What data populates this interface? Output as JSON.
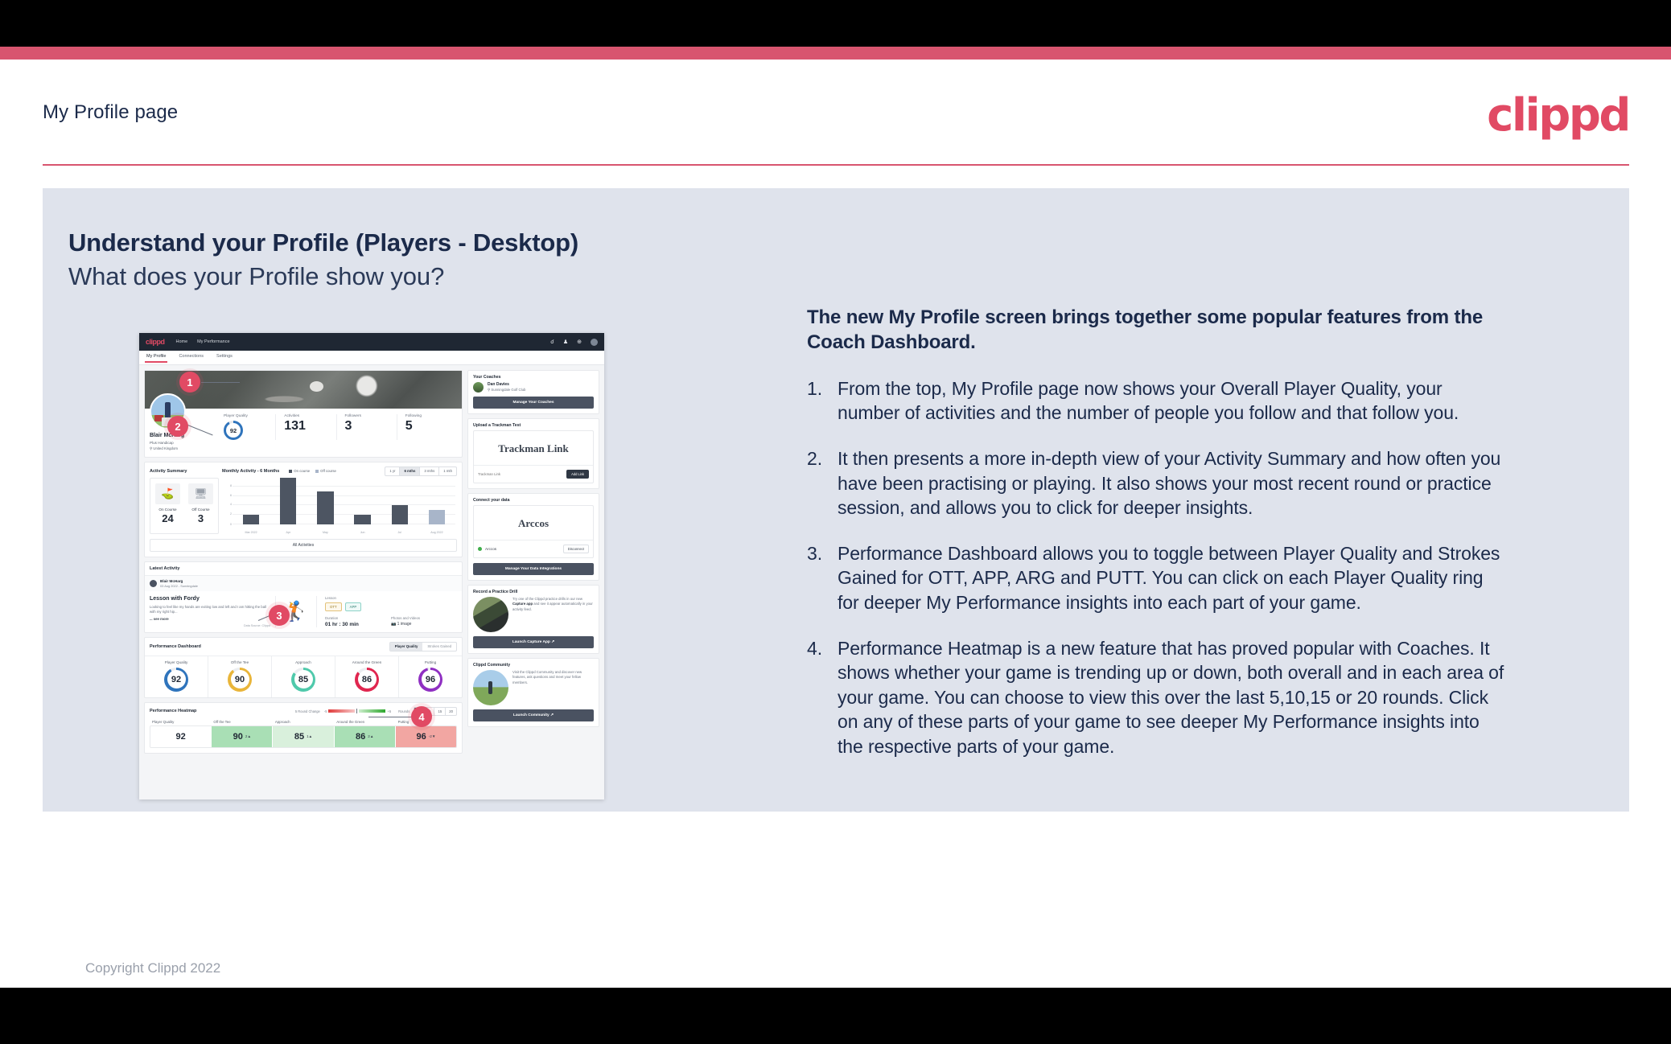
{
  "header": {
    "title": "My Profile page",
    "brand": "clippd"
  },
  "slide": {
    "title_main": "Understand your Profile (Players - Desktop)",
    "title_sub": "What does your Profile show you?",
    "copyright": "Copyright Clippd 2022"
  },
  "text_column": {
    "lead": "The new My Profile screen brings together some popular features from the Coach Dashboard.",
    "items": [
      {
        "num": "1.",
        "text": "From the top, My Profile page now shows your Overall Player Quality, your number of activities and the number of people you follow and that follow you."
      },
      {
        "num": "2.",
        "text": "It then presents a more in-depth view of your Activity Summary and how often you have been practising or playing. It also shows your most recent round or practice session, and allows you to click for deeper insights."
      },
      {
        "num": "3.",
        "text": "Performance Dashboard allows you to toggle between Player Quality and Strokes Gained for OTT, APP, ARG and PUTT. You can click on each Player Quality ring for deeper My Performance insights into each part of your game."
      },
      {
        "num": "4.",
        "text": "Performance Heatmap is a new feature that has proved popular with Coaches. It shows whether your game is trending up or down, both overall and in each area of your game. You can choose to view this over the last 5,10,15 or 20 rounds. Click on any of these parts of your game to see deeper My Performance insights into the respective parts of your game."
      }
    ]
  },
  "callouts": [
    {
      "label": "1"
    },
    {
      "label": "2"
    },
    {
      "label": "3"
    },
    {
      "label": "4"
    }
  ],
  "app": {
    "nav": {
      "logo": "clippd",
      "links": [
        "Home",
        "My Performance"
      ],
      "icons": [
        "search-icon",
        "community-icon",
        "add-circle-icon",
        "avatar-icon"
      ]
    },
    "tabs": [
      {
        "label": "My Profile",
        "active": true
      },
      {
        "label": "Connections",
        "active": false
      },
      {
        "label": "Settings",
        "active": false
      }
    ],
    "profile": {
      "name": "Blair McHarg",
      "handicap": "Plus Handicap",
      "location": "United Kingdom",
      "stats": [
        {
          "label": "Player Quality",
          "value": "92",
          "type": "ring",
          "color": "#2f74bc"
        },
        {
          "label": "Activities",
          "value": "131",
          "type": "number"
        },
        {
          "label": "Followers",
          "value": "3",
          "type": "number"
        },
        {
          "label": "Following",
          "value": "5",
          "type": "number"
        }
      ]
    },
    "activity_summary": {
      "heading": "Activity Summary",
      "chart_title": "Monthly Activity - 6 Months",
      "legend": [
        {
          "label": "On course",
          "color": "#4d5562"
        },
        {
          "label": "Off course",
          "color": "#a8b5c9"
        }
      ],
      "range_options": [
        "1 yr",
        "6 mths",
        "3 mths",
        "1 mth"
      ],
      "range_selected": "6 mths",
      "counters": [
        {
          "label": "On Course",
          "value": "24",
          "icon": "golf-flag-icon"
        },
        {
          "label": "Off Course",
          "value": "3",
          "icon": "monitor-icon"
        }
      ],
      "all_activities_label": "All Activities"
    },
    "latest_activity": {
      "heading": "Latest Activity",
      "user": "Blair McHarg",
      "meta": "03 Aug 2022 - Sunningdale",
      "title": "Lesson with Fordy",
      "description": "Looking to feel like my hands are exiting low and left and I am hitting the ball with my right hip...",
      "see_more": "... see more",
      "data_source": "Data Source: Clippd",
      "type_label": "Lesson",
      "tags": [
        "OTT",
        "APP"
      ],
      "duration_label": "Duration",
      "duration_value": "01 hr : 30 min",
      "photos_label": "Photos and Videos",
      "photos_value": "1 image"
    },
    "performance_dashboard": {
      "heading": "Performance Dashboard",
      "toggle": [
        "Player Quality",
        "Strokes Gained"
      ],
      "toggle_selected": "Player Quality",
      "rings": [
        {
          "label": "Player Quality",
          "value": "92",
          "color": "#2f74bc"
        },
        {
          "label": "Off the Tee",
          "value": "90",
          "color": "#e9b53a"
        },
        {
          "label": "Approach",
          "value": "85",
          "color": "#4fc9ab"
        },
        {
          "label": "Around the Green",
          "value": "86",
          "color": "#e0264f"
        },
        {
          "label": "Putting",
          "value": "96",
          "color": "#8f2fc2"
        }
      ]
    },
    "performance_heatmap": {
      "heading": "Performance Heatmap",
      "change_label": "5 Round Change",
      "scale_min": "-5",
      "scale_max": "+5",
      "rounds_label": "Rounds",
      "rounds_options": [
        "5",
        "10",
        "15",
        "20"
      ],
      "rounds_selected": "5",
      "cells": [
        {
          "label": "Player Quality",
          "value": "92",
          "delta": "",
          "arrow": "",
          "bg": "#ffffff"
        },
        {
          "label": "Off the Tee",
          "value": "90",
          "delta": "2",
          "arrow": "▲",
          "bg": "#a9dfb5"
        },
        {
          "label": "Approach",
          "value": "85",
          "delta": "1",
          "arrow": "▲",
          "bg": "#d9f0dc"
        },
        {
          "label": "Around the Green",
          "value": "86",
          "delta": "2",
          "arrow": "▲",
          "bg": "#a9dfb5"
        },
        {
          "label": "Putting",
          "value": "96",
          "delta": "-2",
          "arrow": "▼",
          "bg": "#f2a6a2"
        }
      ]
    },
    "sidebar": {
      "coaches": {
        "heading": "Your Coaches",
        "coach_name": "Dan Davies",
        "coach_club": "Sunningdale Golf Club",
        "button": "Manage Your Coaches"
      },
      "trackman": {
        "heading": "Upload a Trackman Test",
        "brand": "Trackman Link",
        "placeholder": "Trackman Link",
        "button": "Add Link"
      },
      "connect": {
        "heading": "Connect your data",
        "brand": "Arccos",
        "source": "Arccos",
        "button_small": "Disconnect",
        "button": "Manage Your Data Integrations"
      },
      "drill": {
        "heading": "Record a Practice Drill",
        "text_before": "Try one of the Clippd practice drills in our new ",
        "text_bold": "Capture app",
        "text_after": " and see it appear automatically in your activity feed.",
        "button": "Launch Capture App"
      },
      "community": {
        "heading": "Clippd Community",
        "text": "Visit the Clippd Community and discover new features, ask questions and meet your fellow members.",
        "button": "Launch Community"
      }
    }
  },
  "chart_data": {
    "type": "bar",
    "title": "Monthly Activity - 6 Months",
    "categories": [
      "Mar 2022",
      "Apr",
      "May",
      "Jun",
      "Jul",
      "Aug 2022"
    ],
    "values": [
      2,
      10,
      7,
      2,
      4,
      3
    ],
    "colors": [
      "#4d5562",
      "#4d5562",
      "#4d5562",
      "#4d5562",
      "#4d5562",
      "#a8b5c9"
    ],
    "series": [
      {
        "name": "On course",
        "values": [
          2,
          10,
          7,
          2,
          4,
          0
        ]
      },
      {
        "name": "Off course",
        "values": [
          0,
          0,
          0,
          0,
          0,
          3
        ]
      }
    ],
    "ylim": [
      0,
      10
    ],
    "yticks": [
      0,
      2,
      4,
      6,
      8
    ],
    "xlabel": "",
    "ylabel": "",
    "grid": true,
    "legend_position": "top"
  }
}
